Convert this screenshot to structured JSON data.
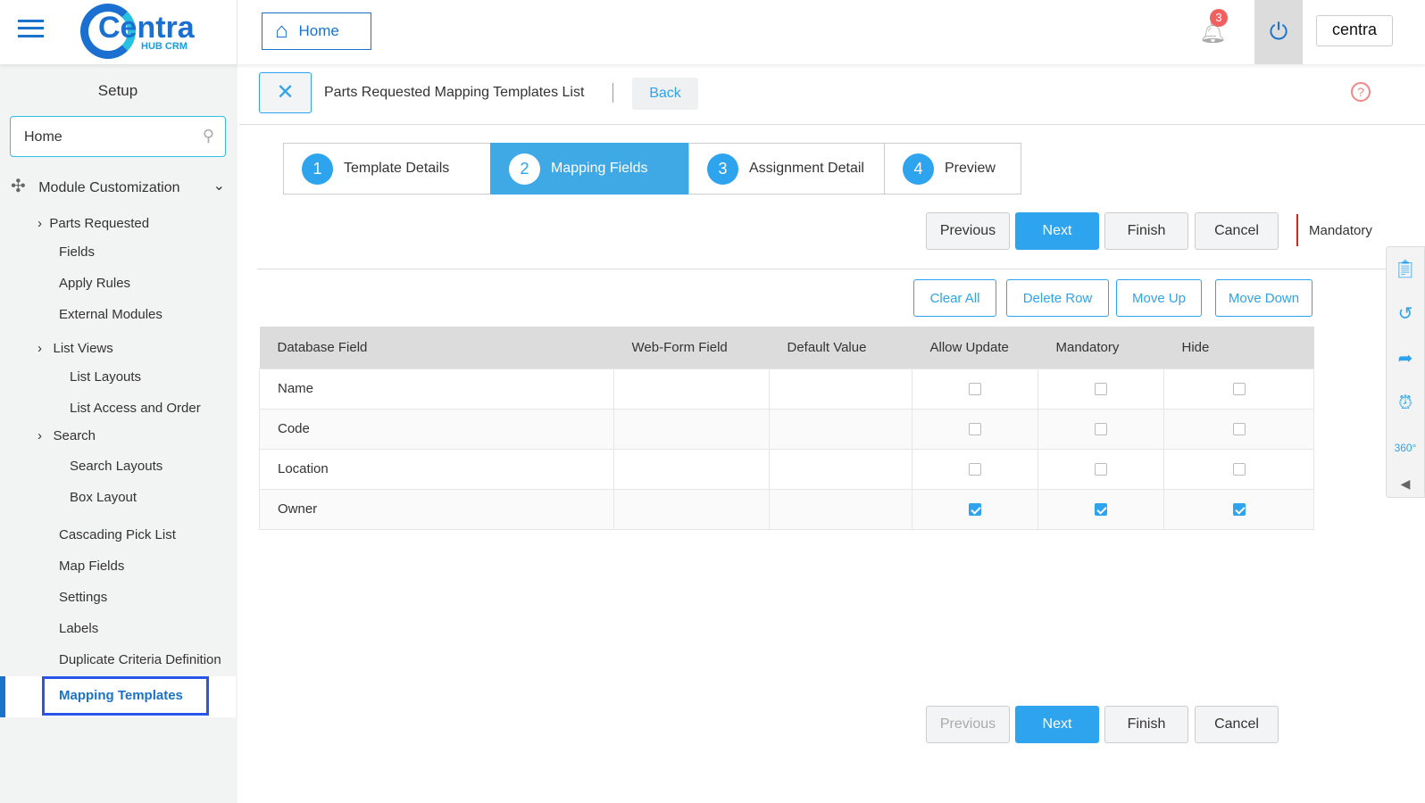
{
  "header": {
    "logo_text": "Centra",
    "logo_sub": "HUB CRM",
    "home_label": "Home",
    "notification_count": "3",
    "brand_badge": "centra"
  },
  "sidebar": {
    "title": "Setup",
    "search_value": "Home",
    "section": "Module Customization",
    "items": [
      "Parts Requested",
      "Fields",
      "Apply Rules",
      "External Modules",
      "List Views",
      "List Layouts",
      "List Access and Order",
      "Search",
      "Search Layouts",
      "Box Layout",
      "Cascading Pick List",
      "Map Fields",
      "Settings",
      "Labels",
      "Duplicate Criteria Definition",
      "Mapping Templates"
    ]
  },
  "page": {
    "title": "Parts Requested Mapping Templates List",
    "back_label": "Back"
  },
  "steps": [
    {
      "num": "1",
      "label": "Template Details"
    },
    {
      "num": "2",
      "label": "Mapping Fields"
    },
    {
      "num": "3",
      "label": "Assignment Detail"
    },
    {
      "num": "4",
      "label": "Preview"
    }
  ],
  "buttons": {
    "previous": "Previous",
    "next": "Next",
    "finish": "Finish",
    "cancel": "Cancel",
    "mandatory_legend": "Mandatory",
    "clear_all": "Clear All",
    "delete_row": "Delete Row",
    "move_up": "Move Up",
    "move_down": "Move Down"
  },
  "table": {
    "headers": [
      "Database Field",
      "Web-Form Field",
      "Default Value",
      "Allow Update",
      "Mandatory",
      "Hide"
    ],
    "rows": [
      {
        "field": "Name",
        "allow_update": false,
        "mandatory": false,
        "hide": false
      },
      {
        "field": "Code",
        "allow_update": false,
        "mandatory": false,
        "hide": false
      },
      {
        "field": "Location",
        "allow_update": false,
        "mandatory": false,
        "hide": false
      },
      {
        "field": "Owner",
        "allow_update": true,
        "mandatory": true,
        "hide": true
      }
    ]
  }
}
